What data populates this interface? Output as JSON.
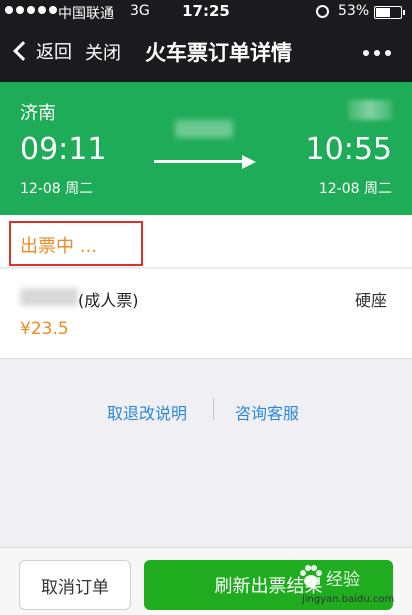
{
  "status_bar": {
    "carrier": "中国联通",
    "network": "3G",
    "time": "17:25",
    "battery_text": "53%",
    "battery_level": 0.53
  },
  "nav": {
    "back_label": "返回",
    "close_label": "关闭",
    "title": "火车票订单详情"
  },
  "train": {
    "from_station": "济南",
    "departure_time": "09:11",
    "arrival_time": "10:55",
    "departure_date": "12-08 周二",
    "arrival_date": "12-08 周二"
  },
  "order": {
    "status": "出票中 ..."
  },
  "ticket": {
    "passenger_type": "(成人票)",
    "seat_type": "硬座",
    "price": "¥23.5"
  },
  "links": {
    "refund_info": "取退改说明",
    "customer_service": "咨询客服"
  },
  "actions": {
    "cancel_label": "取消订单",
    "refresh_label": "刷新出票结果"
  },
  "watermark": {
    "text": "经验",
    "url": "jingyan.baidu.com"
  },
  "colors": {
    "header_bg": "#1b1b1f",
    "train_bg": "#1fac58",
    "status_orange": "#f08a24",
    "link_blue": "#2b88d8",
    "highlight_red": "#e0302b",
    "primary_green": "#1fac1f"
  }
}
